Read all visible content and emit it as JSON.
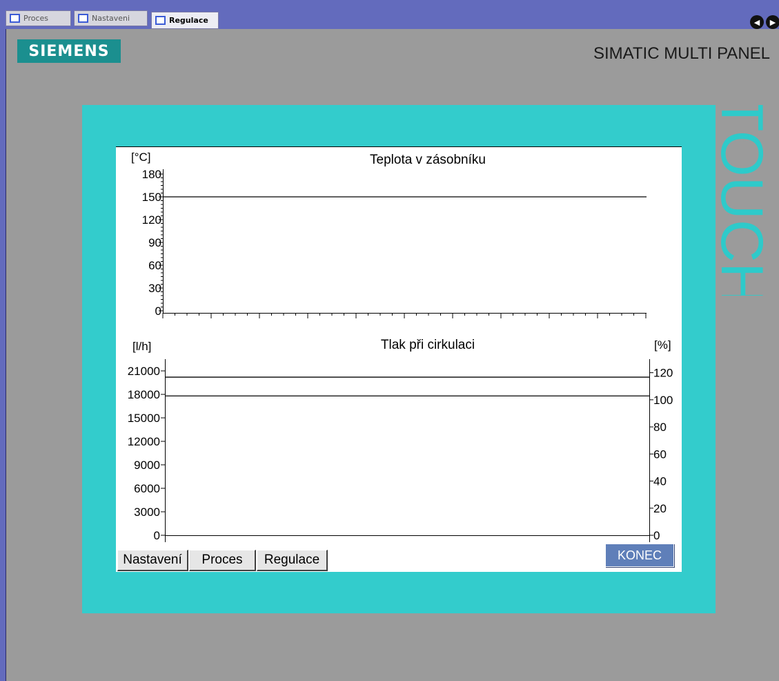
{
  "tabs": [
    {
      "label": "Proces",
      "active": false
    },
    {
      "label": "Nastaveni",
      "active": false
    },
    {
      "label": "Regulace",
      "active": true
    }
  ],
  "nav": {
    "back_icon": "left-arrow-icon",
    "forward_icon": "right-arrow-icon"
  },
  "panel": {
    "logo": "SIEMENS",
    "brand": "SIMATIC MULTI PANEL",
    "vertical_text": "TOUCH",
    "colors": {
      "bezel": "#33cccc",
      "logo_bg": "#1b8f8f",
      "window_frame": "#636bbd",
      "konec_bg": "#5f7fb9"
    }
  },
  "chart_data": [
    {
      "type": "line",
      "title": "Teplota v zásobníku",
      "ylabel": "[°C]",
      "ylim": [
        0,
        180
      ],
      "yticks": [
        "0",
        "30",
        "60",
        "90",
        "120",
        "150",
        "180"
      ],
      "series": [
        {
          "values": [
            150,
            150
          ]
        }
      ]
    },
    {
      "type": "line",
      "title": "Tlak při cirkulaci",
      "ylabel": "[l/h]",
      "ylim": [
        0,
        22500
      ],
      "yticks": [
        "0",
        "3000",
        "6000",
        "9000",
        "12000",
        "15000",
        "18000",
        "21000"
      ],
      "y2label": "[%]",
      "y2lim": [
        0,
        130
      ],
      "y2ticks": [
        "0",
        "20",
        "40",
        "60",
        "80",
        "100",
        "120"
      ],
      "series": [
        {
          "values": [
            20200,
            20200
          ]
        },
        {
          "values": [
            17800,
            17800
          ]
        }
      ]
    }
  ],
  "buttons": {
    "nastaveni": "Nastavení",
    "proces": "Proces",
    "regulace": "Regulace",
    "konec": "KONEC"
  }
}
